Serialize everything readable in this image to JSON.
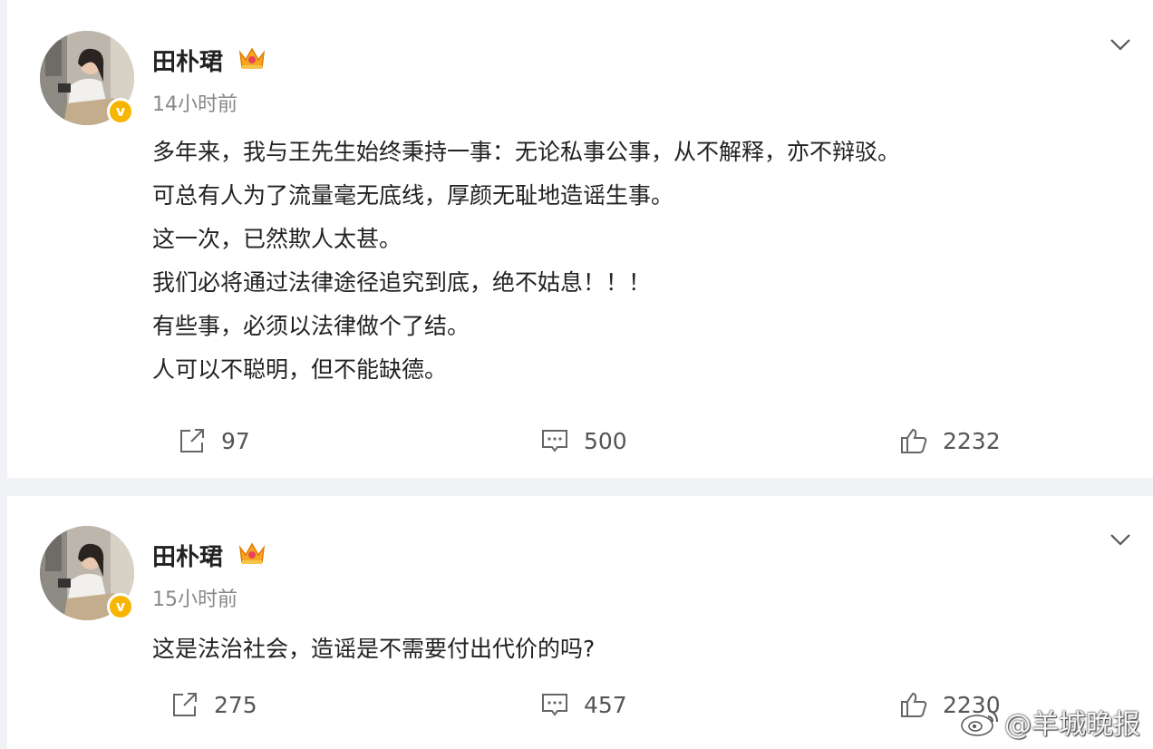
{
  "posts": [
    {
      "author": "田朴珺",
      "time": "14小时前",
      "lines": [
        "多年来，我与王先生始终秉持一事：无论私事公事，从不解释，亦不辩驳。",
        "可总有人为了流量毫无底线，厚颜无耻地造谣生事。",
        "这一次，已然欺人太甚。",
        "我们必将通过法律途径追究到底，绝不姑息！！！",
        "有些事，必须以法律做个了结。",
        "人可以不聪明，但不能缺德。"
      ],
      "repost_count": "97",
      "comment_count": "500",
      "like_count": "2232"
    },
    {
      "author": "田朴珺",
      "time": "15小时前",
      "lines": [
        "这是法治社会，造谣是不需要付出代价的吗?"
      ],
      "repost_count": "275",
      "comment_count": "457",
      "like_count": "2230"
    }
  ],
  "verified_badge": "v",
  "watermark": "@羊城晚报",
  "icons": {
    "repost": "share-arrow-icon",
    "comment": "comment-bubble-icon",
    "like": "thumbs-up-icon",
    "menu": "chevron-down-icon",
    "crown": "crown-badge-icon",
    "weibo": "weibo-logo-icon"
  },
  "colors": {
    "background": "#f1f2f5",
    "card": "#ffffff",
    "verified": "#f7b500",
    "text": "#222222",
    "meta": "#888888"
  }
}
